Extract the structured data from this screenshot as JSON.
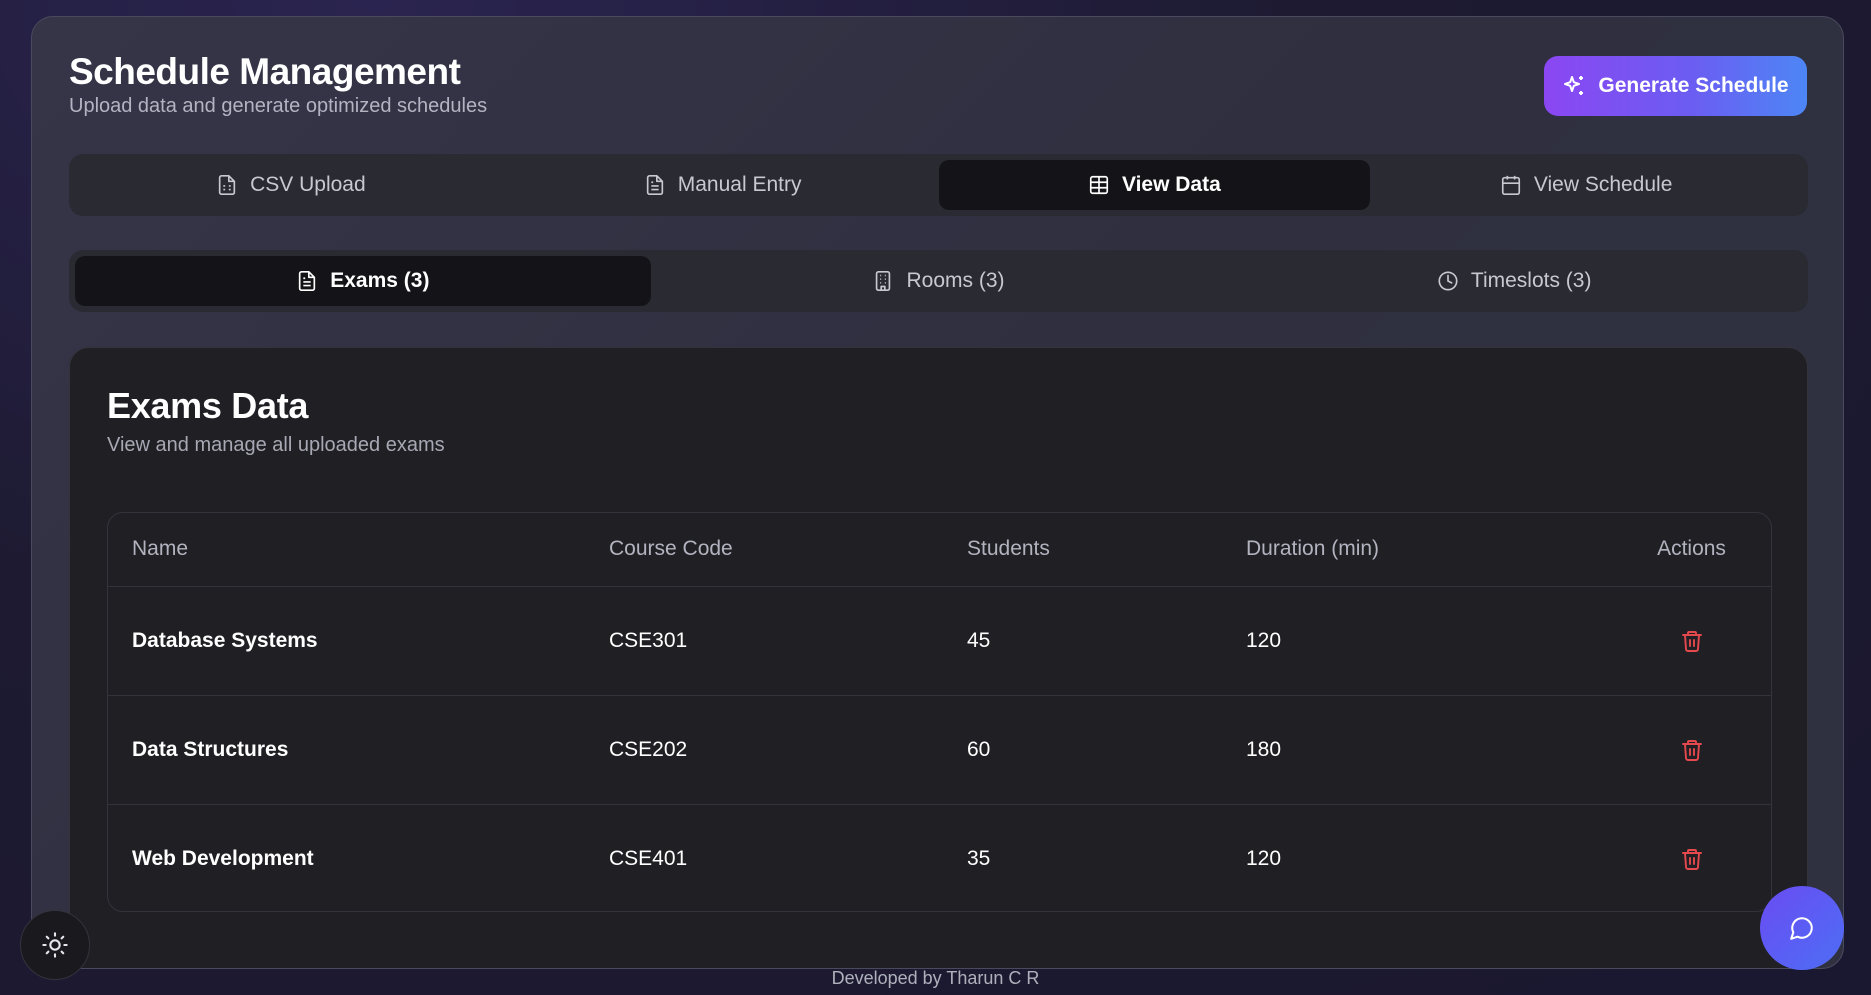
{
  "header": {
    "title": "Schedule Management",
    "subtitle": "Upload data and generate optimized schedules",
    "generate_label": "Generate Schedule"
  },
  "tabs": [
    {
      "label": "CSV Upload",
      "icon": "file-spreadsheet-icon",
      "active": false
    },
    {
      "label": "Manual Entry",
      "icon": "file-text-icon",
      "active": false
    },
    {
      "label": "View Data",
      "icon": "table-icon",
      "active": true
    },
    {
      "label": "View Schedule",
      "icon": "calendar-icon",
      "active": false
    }
  ],
  "subtabs": [
    {
      "label": "Exams (3)",
      "icon": "file-text-icon",
      "active": true
    },
    {
      "label": "Rooms (3)",
      "icon": "building-icon",
      "active": false
    },
    {
      "label": "Timeslots (3)",
      "icon": "clock-icon",
      "active": false
    }
  ],
  "card": {
    "title": "Exams Data",
    "subtitle": "View and manage all uploaded exams"
  },
  "table": {
    "headers": [
      "Name",
      "Course Code",
      "Students",
      "Duration (min)",
      "Actions"
    ],
    "rows": [
      {
        "name": "Database Systems",
        "code": "CSE301",
        "students": "45",
        "duration": "120"
      },
      {
        "name": "Data Structures",
        "code": "CSE202",
        "students": "60",
        "duration": "180"
      },
      {
        "name": "Web Development",
        "code": "CSE401",
        "students": "35",
        "duration": "120"
      }
    ]
  },
  "footer": "Developed by Tharun C R",
  "colors": {
    "accent_start": "#8b47f2",
    "accent_end": "#4d86f5",
    "delete": "#e5484d"
  }
}
